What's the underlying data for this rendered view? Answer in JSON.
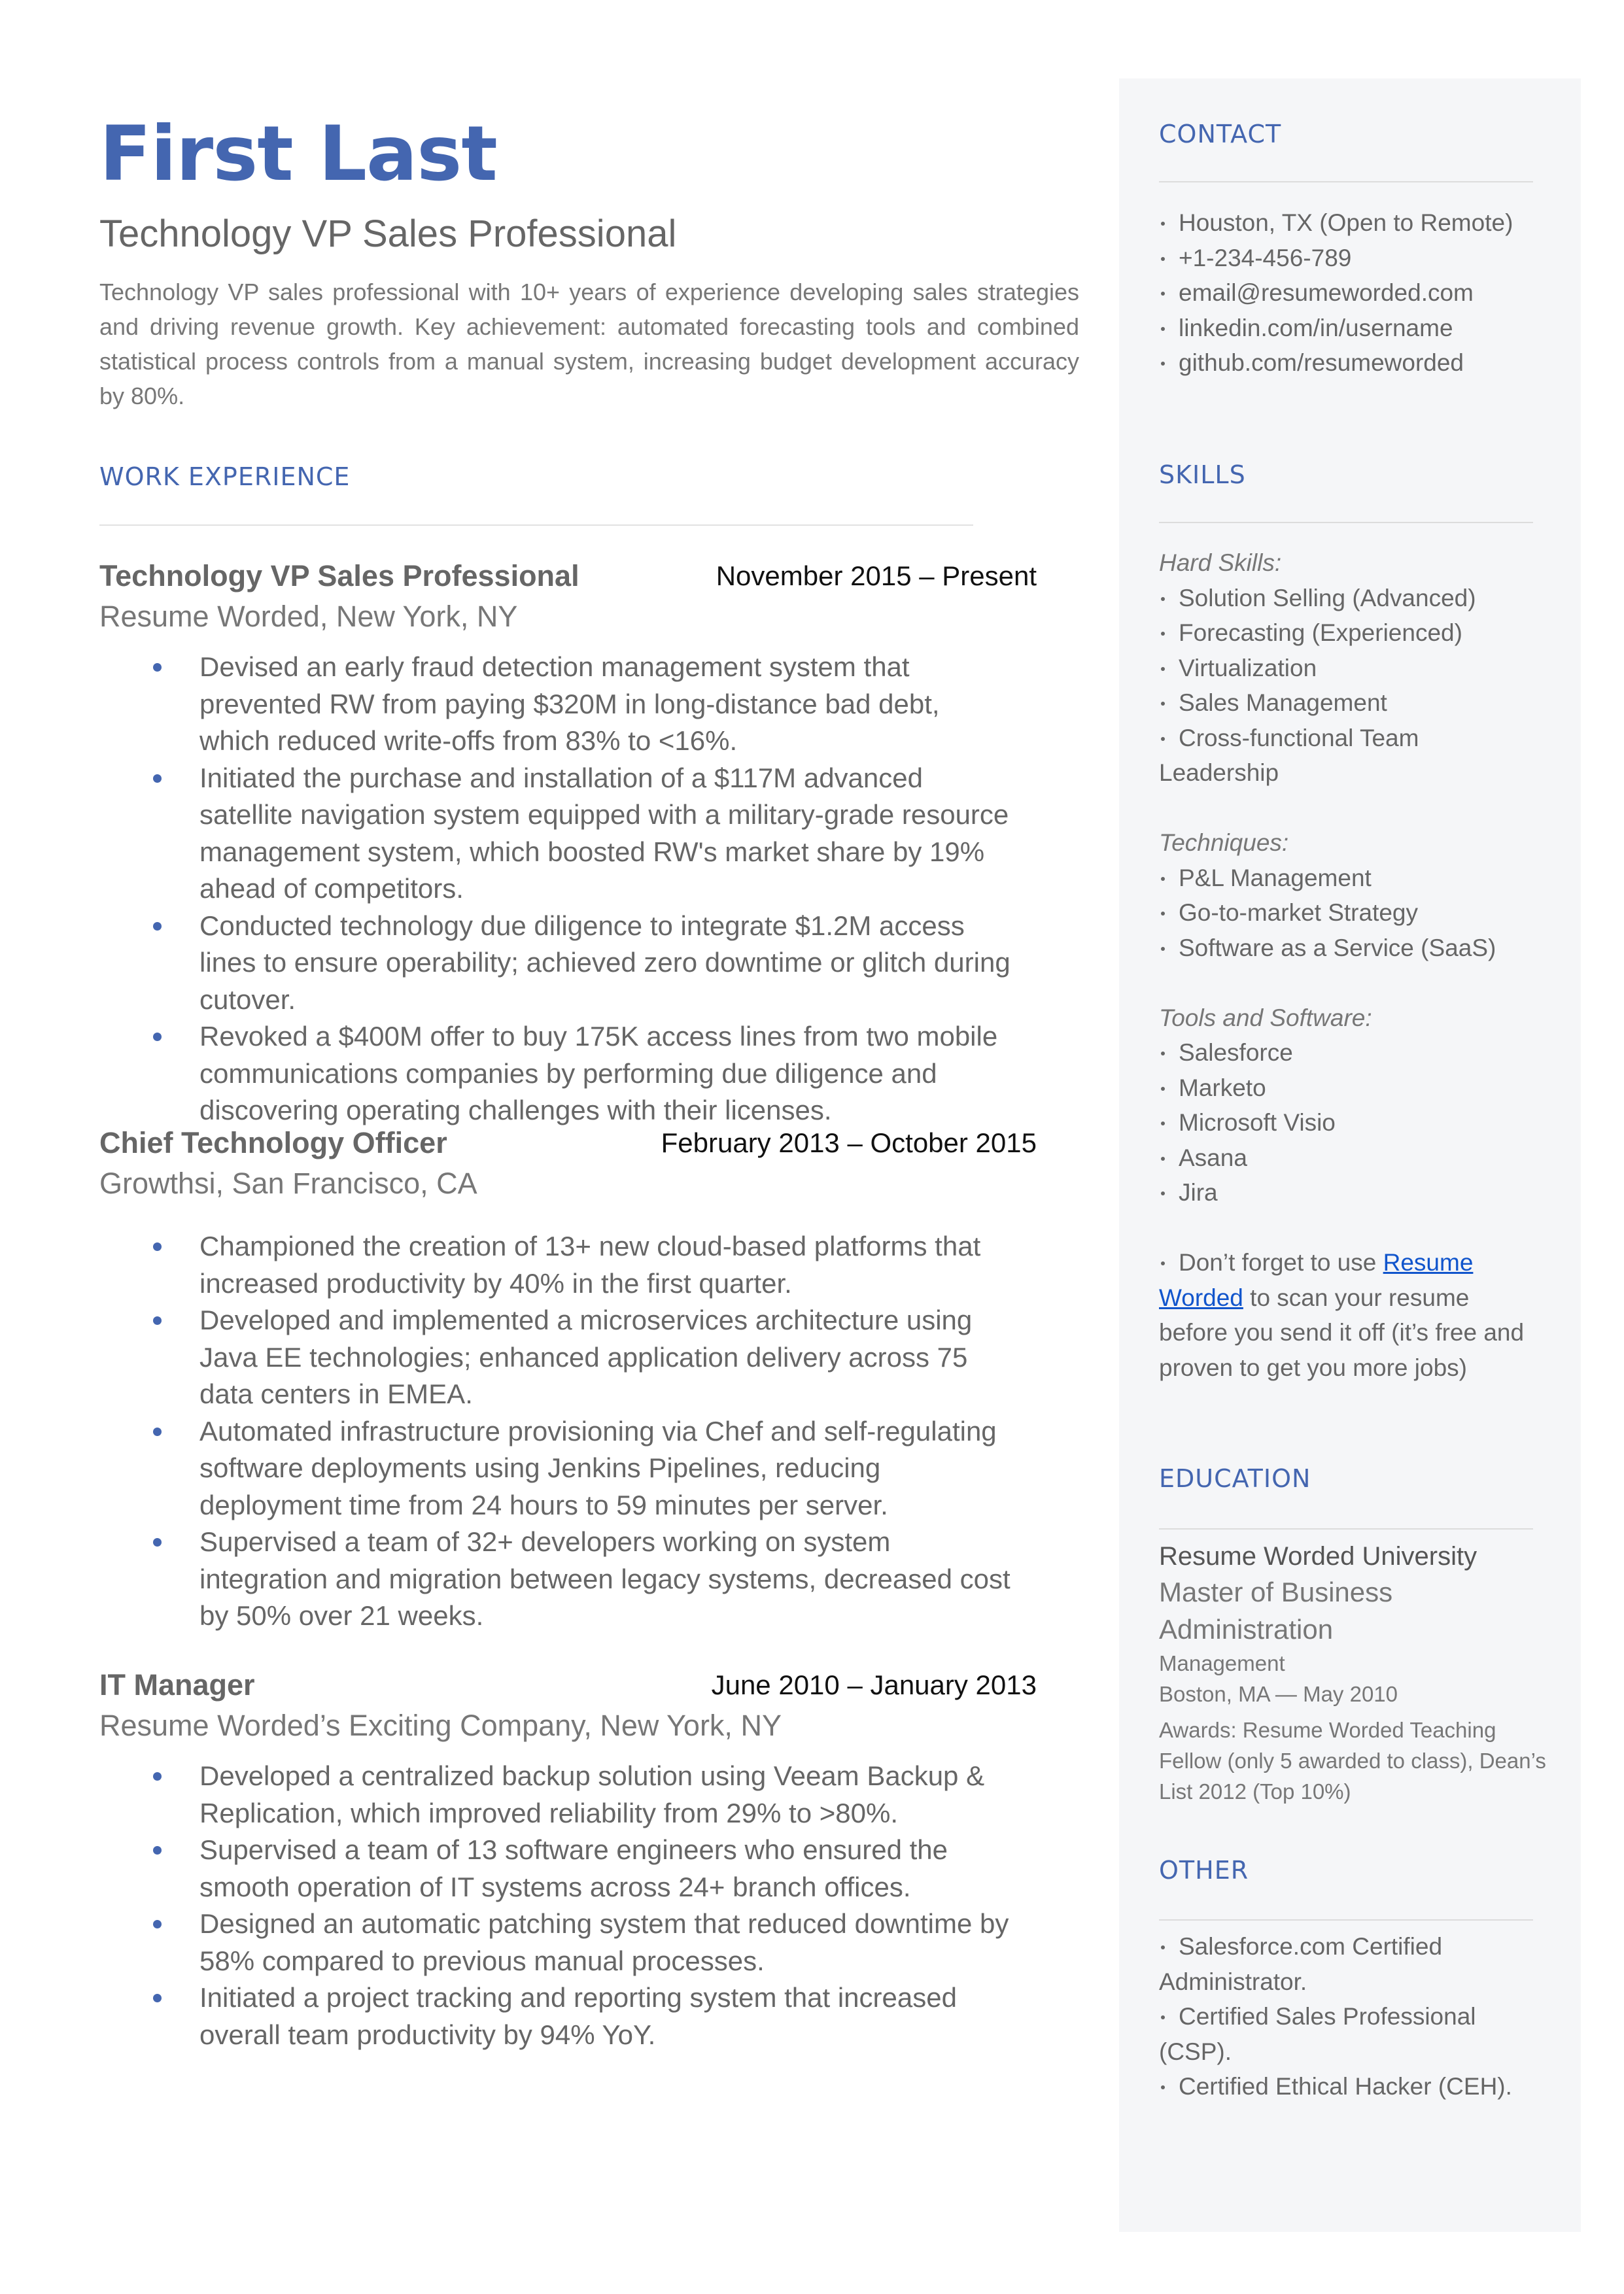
{
  "header": {
    "name": "First Last",
    "title": "Technology VP Sales Professional",
    "summary": "Technology VP sales professional with 10+ years of experience developing sales strategies and driving revenue growth. Key achievement: automated forecasting tools and combined statistical process controls from a manual system, increasing budget development accuracy by 80%."
  },
  "work": {
    "heading": "WORK EXPERIENCE",
    "jobs": [
      {
        "title": "Technology VP Sales Professional",
        "dates": "November 2015 – Present",
        "company": "Resume Worded, New York, NY",
        "bullets": [
          "Devised an early fraud detection management system that prevented RW from paying $320M in long-distance bad debt, which reduced write-offs from 83% to <16%.",
          "Initiated the purchase and installation of a $117M advanced satellite navigation system equipped with a military-grade resource management system, which boosted RW's market share by 19% ahead of competitors.",
          "Conducted technology due diligence to integrate $1.2M access lines to ensure operability; achieved zero downtime or glitch during cutover.",
          "Revoked a $400M offer to buy 175K access lines from two mobile communications companies by performing due diligence and discovering operating challenges with their licenses."
        ]
      },
      {
        "title": "Chief Technology Officer",
        "dates": "February 2013 – October 2015",
        "company": "Growthsi, San Francisco, CA",
        "bullets": [
          "Championed the creation of 13+ new cloud-based platforms that increased productivity by 40% in the first quarter.",
          "Developed and implemented a microservices architecture using Java EE technologies; enhanced application delivery across 75 data centers in EMEA.",
          "Automated infrastructure provisioning via Chef and self-regulating software deployments using Jenkins Pipelines, reducing deployment time from 24 hours to 59 minutes per server.",
          "Supervised a team of 32+ developers working on system integration and migration between legacy systems, decreased cost by 50% over 21 weeks."
        ]
      },
      {
        "title": "IT Manager",
        "dates": "June 2010 – January 2013",
        "company": "Resume Worded’s Exciting Company, New York, NY",
        "bullets": [
          "Developed a centralized backup solution using Veeam Backup & Replication, which improved reliability from 29% to >80%.",
          "Supervised a team of 13 software engineers who ensured the smooth operation of IT systems across 24+ branch offices.",
          "Designed an automatic patching system that reduced downtime by 58% compared to previous manual processes.",
          "Initiated a project tracking and reporting system that increased overall team productivity by 94% YoY."
        ]
      }
    ]
  },
  "contact": {
    "heading": "CONTACT",
    "items": [
      "Houston, TX (Open to Remote)",
      "+1-234-456-789",
      "email@resumeworded.com",
      "linkedin.com/in/username",
      "github.com/resumeworded"
    ]
  },
  "skills": {
    "heading": "SKILLS",
    "groups": [
      {
        "label": "Hard Skills:",
        "items": [
          "Solution Selling (Advanced)",
          "Forecasting (Experienced)",
          "Virtualization",
          "Sales Management",
          "Cross-functional Team Leadership"
        ]
      },
      {
        "label": "Techniques:",
        "items": [
          "P&L Management",
          "Go-to-market Strategy",
          "Software as a Service (SaaS)"
        ]
      },
      {
        "label": "Tools and Software:",
        "items": [
          "Salesforce",
          "Marketo",
          "Microsoft Visio",
          "Asana",
          "Jira"
        ]
      }
    ],
    "tip": {
      "prefix": "Don’t forget to use ",
      "link": "Resume Worded",
      "suffix": " to scan your resume before you send it off (it’s free and proven to get you more jobs)"
    }
  },
  "education": {
    "heading": "EDUCATION",
    "school": "Resume Worded University",
    "degree": "Master of Business Administration",
    "field": "Management",
    "location_date": "Boston, MA — May 2010",
    "awards": "Awards: Resume Worded Teaching Fellow (only 5 awarded to class), Dean’s List 2012 (Top 10%)"
  },
  "other": {
    "heading": "OTHER",
    "items": [
      "Salesforce.com Certified Administrator.",
      "Certified Sales Professional (CSP).",
      "Certified Ethical Hacker (CEH)."
    ]
  },
  "colors": {
    "accent": "#4466B0",
    "sidebar_bg": "#F5F6F8",
    "link": "#1155CC"
  }
}
